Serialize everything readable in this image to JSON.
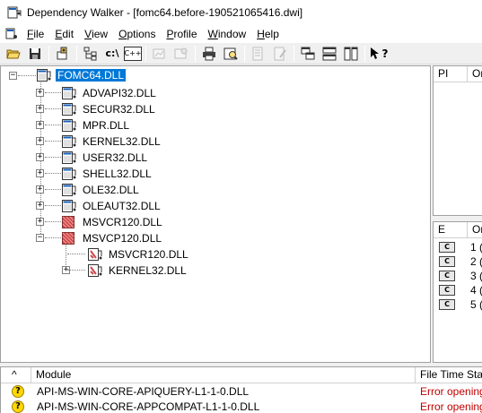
{
  "window": {
    "title": "Dependency Walker - [fomc64.before-190521065416.dwi]"
  },
  "menu": {
    "items": [
      {
        "label": "File",
        "u": "F",
        "rest": "ile"
      },
      {
        "label": "Edit",
        "u": "E",
        "rest": "dit"
      },
      {
        "label": "View",
        "u": "V",
        "rest": "iew"
      },
      {
        "label": "Options",
        "u": "O",
        "rest": "ptions"
      },
      {
        "label": "Profile",
        "u": "P",
        "rest": "rofile"
      },
      {
        "label": "Window",
        "u": "W",
        "rest": "indow"
      },
      {
        "label": "Help",
        "u": "H",
        "rest": "elp"
      }
    ]
  },
  "toolbar": {
    "path_label": "c:\\",
    "cpp_label": "C++",
    "help_label": "?"
  },
  "tree": {
    "root": "FOMC64.DLL",
    "children": [
      "ADVAPI32.DLL",
      "SECUR32.DLL",
      "MPR.DLL",
      "KERNEL32.DLL",
      "USER32.DLL",
      "SHELL32.DLL",
      "OLE32.DLL",
      "OLEAUT32.DLL",
      "MSVCR120.DLL",
      "MSVCP120.DLL"
    ],
    "grandchildren": [
      "MSVCR120.DLL",
      "KERNEL32.DLL"
    ]
  },
  "import_panel": {
    "col_pi": "PI",
    "col_or": "Or"
  },
  "export_panel": {
    "col_e": "E",
    "col_or": "Or",
    "icon_text": "C",
    "rows": [
      "1 (",
      "2 (",
      "3 (",
      "4 (",
      "5 ("
    ]
  },
  "module_list": {
    "col_sort": "^",
    "col_module": "Module",
    "col_time": "File Time Star",
    "rows": [
      {
        "name": "API-MS-WIN-CORE-APIQUERY-L1-1-0.DLL",
        "status": "Error opening"
      },
      {
        "name": "API-MS-WIN-CORE-APPCOMPAT-L1-1-0.DLL",
        "status": "Error opening"
      }
    ]
  }
}
